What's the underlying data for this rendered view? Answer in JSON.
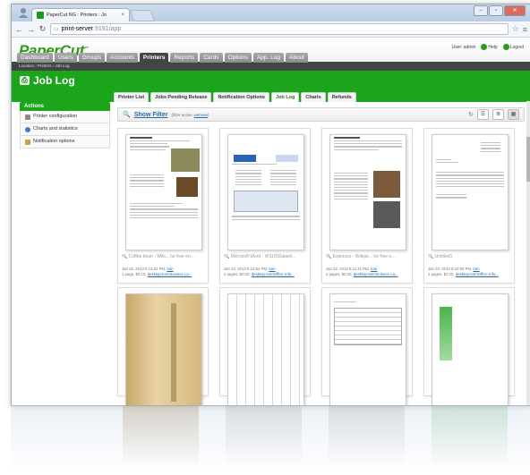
{
  "browser": {
    "tab_title": "PaperCut NG : Printers : Jo",
    "tab_close": "×",
    "url_host": "print-server",
    "url_path": ":9191/app"
  },
  "app": {
    "logo": "PaperCut",
    "logo_mark": "™",
    "user_label": "User: admin",
    "help": "Help",
    "logout": "Logout"
  },
  "nav": {
    "items": [
      "Dashboard",
      "Users",
      "Groups",
      "Accounts",
      "Printers",
      "Reports",
      "Cards",
      "Options",
      "App. Log",
      "About"
    ],
    "active": "Printers"
  },
  "breadcrumb": "Location › Printers › Job Log",
  "page_title": "Job Log",
  "subtabs": {
    "items": [
      "Printer List",
      "Jobs Pending Release",
      "Notification Options",
      "Job Log",
      "Charts",
      "Refunds"
    ],
    "active": "Job Log"
  },
  "sidebar": {
    "header": "Actions",
    "items": [
      "Printer configuration",
      "Charts and statistics",
      "Notification options"
    ]
  },
  "filter": {
    "label": "Show Filter",
    "note_prefix": "(filter active:",
    "note_link": "remove",
    "note_suffix": ")"
  },
  "jobs": [
    {
      "caption": "Coffee bean - Wiki... he free en...",
      "line1_prefix": "Jan 22, 2013 6:13:32 PM,",
      "line1_user": "tom",
      "line2_prefix": "1 page, $0.10,",
      "line2_printer": "desktop-tom\\Science La..."
    },
    {
      "caption": "Microsoft Word - WSUSDatash...",
      "line1_prefix": "Jan 22, 2013 6:12:54 PM,",
      "line1_user": "tom",
      "line2_prefix": "2 pages, $0.20,",
      "line2_printer": "desktop-tom\\Office Info..."
    },
    {
      "caption": "Espresso - Wikipe... he free e...",
      "line1_prefix": "Jan 22, 2013 6:11:41 PM,",
      "line1_user": "tom",
      "line2_prefix": "2 pages, $0.20,",
      "line2_printer": "desktop-tom\\Science La..."
    },
    {
      "caption": "Untitled1",
      "line1_prefix": "Jan 22, 2013 6:10:50 PM,",
      "line1_user": "tom",
      "line2_prefix": "2 pages, $0.20,",
      "line2_printer": "desktop-tom\\Office Info..."
    }
  ],
  "colors": {
    "brand_green": "#1aa51a",
    "nav_dark": "#444444",
    "link_blue": "#2a6aa0"
  }
}
